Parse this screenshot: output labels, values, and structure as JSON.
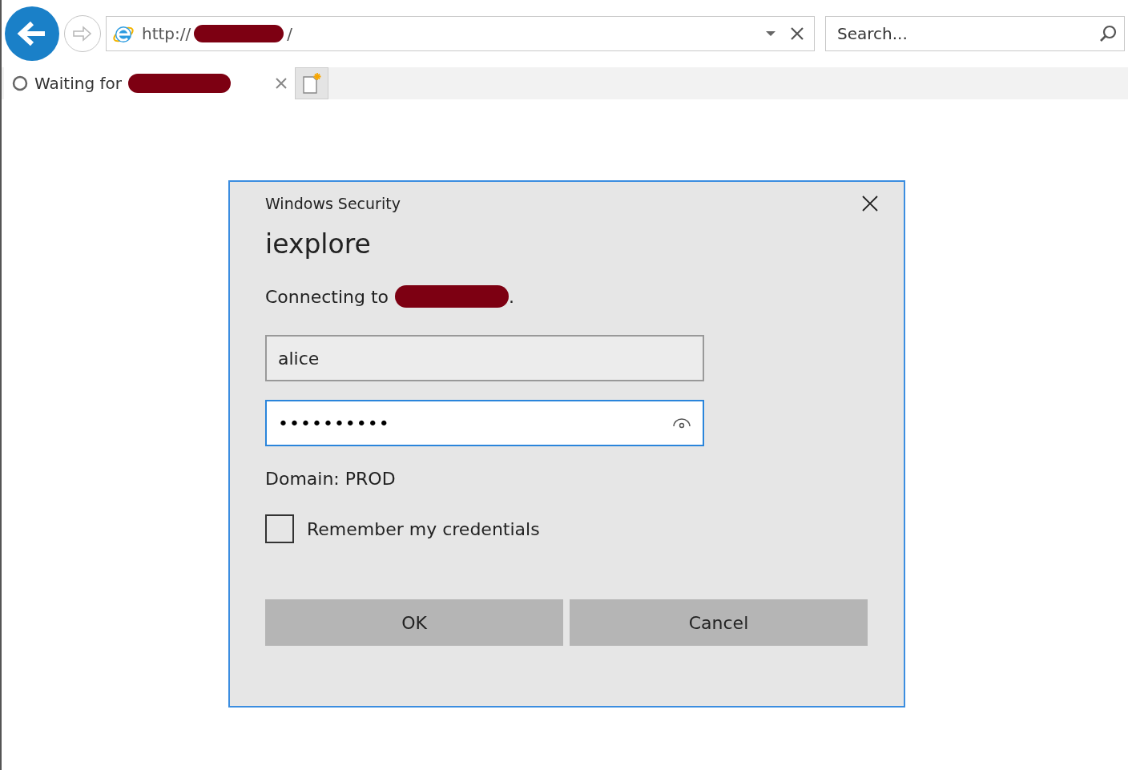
{
  "browser": {
    "address": {
      "before": "http://",
      "after": "/"
    },
    "search": {
      "placeholder": "Search..."
    },
    "tabs": [
      {
        "label": "Waiting for",
        "selected": true
      }
    ]
  },
  "dialog": {
    "title": "Windows Security",
    "heading": "iexplore",
    "message": {
      "before": "Connecting to",
      "after": "."
    },
    "username": {
      "value": "alice"
    },
    "password": {
      "value": "••••••••••",
      "focused": true
    },
    "domain": "Domain: PROD",
    "remember": {
      "label": "Remember my credentials",
      "checked": false
    },
    "buttons": [
      "OK",
      "Cancel"
    ]
  }
}
